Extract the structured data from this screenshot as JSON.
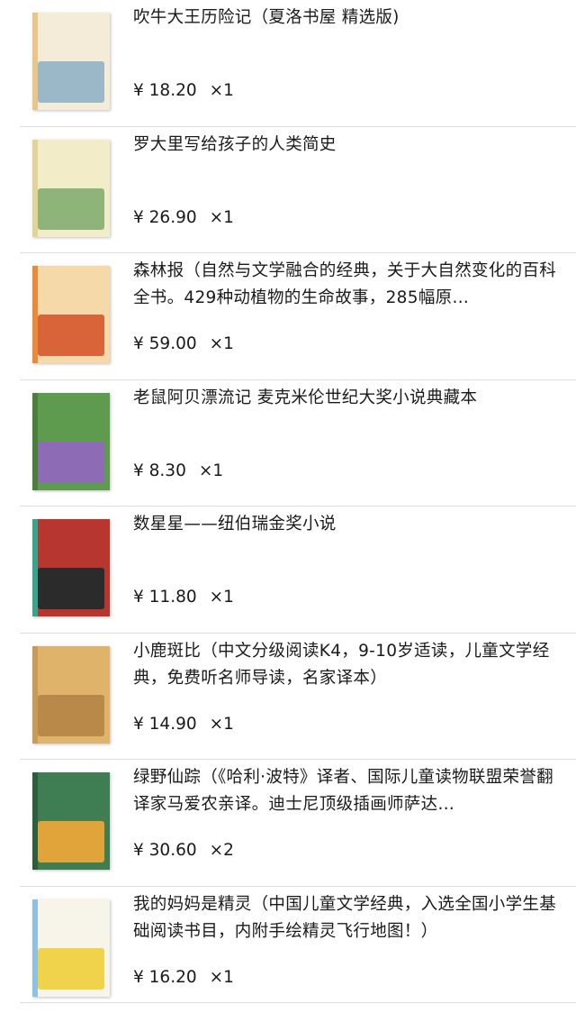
{
  "items": [
    {
      "title": "吹牛大王历险记（夏洛书屋 精选版)",
      "price": "¥ 18.20",
      "quantity": "×1",
      "cover_icon": "book-cover-baron-munchausen",
      "cover_colors": {
        "bg": "#f4ecd8",
        "art": "#9bb8c9",
        "strip": "#e7c68b"
      }
    },
    {
      "title": "罗大里写给孩子的人类简史",
      "price": "¥ 26.90",
      "quantity": "×1",
      "cover_icon": "book-cover-dinosaur",
      "cover_colors": {
        "bg": "#f3ecc8",
        "art": "#8fb47a",
        "strip": "#e0d49a"
      }
    },
    {
      "title": "森林报（自然与文学融合的经典，关于大自然变化的百科全书。429种动植物的生命故事，285幅原…",
      "price": "¥ 59.00",
      "quantity": "×1",
      "cover_icon": "book-cover-forest",
      "cover_colors": {
        "bg": "#f6d9a8",
        "art": "#d9643a",
        "strip": "#e98a3a"
      }
    },
    {
      "title": "老鼠阿贝漂流记      麦克米伦世纪大奖小说典藏本",
      "price": "¥ 8.30",
      "quantity": "×1",
      "cover_icon": "book-cover-mouse",
      "cover_colors": {
        "bg": "#5f9b4f",
        "art": "#8e6bb5",
        "strip": "#4b7d3b"
      }
    },
    {
      "title": "数星星——纽伯瑞金奖小说",
      "price": "¥ 11.80",
      "quantity": "×1",
      "cover_icon": "book-cover-stars",
      "cover_colors": {
        "bg": "#b7362f",
        "art": "#2b2b2b",
        "strip": "#3aa38b"
      }
    },
    {
      "title": "小鹿斑比（中文分级阅读K4，9-10岁适读，儿童文学经典，免费听名师导读，名家译本）",
      "price": "¥ 14.90",
      "quantity": "×1",
      "cover_icon": "book-cover-bambi",
      "cover_colors": {
        "bg": "#e0b36a",
        "art": "#b9894a",
        "strip": "#c99a55"
      }
    },
    {
      "title": "绿野仙踪（《哈利·波特》译者、国际儿童读物联盟荣誉翻译家马爱农亲译。迪士尼顶级插画师萨达…",
      "price": "¥ 30.60",
      "quantity": "×2",
      "cover_icon": "book-cover-oz",
      "cover_colors": {
        "bg": "#3f7d52",
        "art": "#e0a43a",
        "strip": "#2d5f3c"
      }
    },
    {
      "title": "我的妈妈是精灵（中国儿童文学经典，入选全国小学生基础阅读书目，内附手绘精灵飞行地图！）",
      "price": "¥ 16.20",
      "quantity": "×1",
      "cover_icon": "book-cover-fairy-mom",
      "cover_colors": {
        "bg": "#f7f4ea",
        "art": "#f1d34b",
        "strip": "#8fc1e0"
      }
    }
  ]
}
